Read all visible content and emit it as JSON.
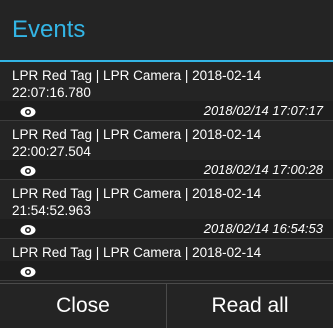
{
  "dialog": {
    "title": "Events",
    "accent_color": "#33b5e5"
  },
  "events": [
    {
      "text": "LPR Red Tag | LPR Camera | 2018-02-14\n22:07:16.780",
      "icon": "eye-icon",
      "time": "2018/02/14 17:07:17"
    },
    {
      "text": "LPR Red Tag | LPR Camera | 2018-02-14\n22:00:27.504",
      "icon": "eye-icon",
      "time": "2018/02/14 17:00:28"
    },
    {
      "text": "LPR Red Tag | LPR Camera | 2018-02-14\n21:54:52.963",
      "icon": "eye-icon",
      "time": "2018/02/14 16:54:53"
    },
    {
      "text": "LPR Red Tag | LPR Camera | 2018-02-14",
      "icon": "eye-icon",
      "time": ""
    }
  ],
  "buttons": {
    "close": "Close",
    "read_all": "Read all"
  }
}
